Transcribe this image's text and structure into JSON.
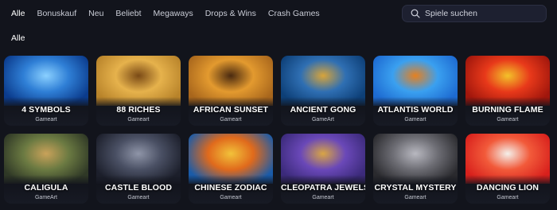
{
  "nav": {
    "tabs": [
      "Alle",
      "Bonuskauf",
      "Neu",
      "Beliebt",
      "Megaways",
      "Drops & Wins",
      "Crash Games"
    ],
    "active_tab": "Alle"
  },
  "search": {
    "placeholder": "Spiele suchen",
    "icon": "search-icon"
  },
  "section": {
    "title": "Alle"
  },
  "games": [
    {
      "title": "4 SYMBOLS",
      "provider": "Gameart",
      "colors": [
        "#0b3b8c",
        "#2f7fd6",
        "#8ad0ff"
      ]
    },
    {
      "title": "88 RICHES",
      "provider": "Gameart",
      "colors": [
        "#b8832a",
        "#e6b24c",
        "#7a4a16"
      ]
    },
    {
      "title": "AFRICAN SUNSET",
      "provider": "Gameart",
      "colors": [
        "#a8661c",
        "#e39a2f",
        "#4a2a10"
      ]
    },
    {
      "title": "ANCIENT GONG",
      "provider": "GameArt",
      "colors": [
        "#0d3f77",
        "#2f6fb3",
        "#d8a43a"
      ]
    },
    {
      "title": "ATLANTIS WORLD",
      "provider": "Gameart",
      "colors": [
        "#1d6ad1",
        "#3aa0f0",
        "#e6801f"
      ]
    },
    {
      "title": "BURNING FLAME",
      "provider": "Gameart",
      "colors": [
        "#a0160c",
        "#e8391a",
        "#f3c22a"
      ]
    },
    {
      "title": "CALIGULA",
      "provider": "GameArt",
      "colors": [
        "#2f3826",
        "#6b7a42",
        "#c9a25a"
      ]
    },
    {
      "title": "CASTLE BLOOD",
      "provider": "Gameart",
      "colors": [
        "#1c1f2b",
        "#4a5064",
        "#8f95a8"
      ]
    },
    {
      "title": "CHINESE ZODIAC",
      "provider": "Gameart",
      "colors": [
        "#1a5ba8",
        "#e06a1c",
        "#f2c23a"
      ]
    },
    {
      "title": "CLEOPATRA JEWELS",
      "provider": "Gameart",
      "colors": [
        "#3b2a7a",
        "#6a48b8",
        "#d9a544"
      ]
    },
    {
      "title": "CRYSTAL MYSTERY",
      "provider": "Gameart",
      "colors": [
        "#2a2a2e",
        "#6d6d74",
        "#b8b8c0"
      ]
    },
    {
      "title": "DANCING LION",
      "provider": "Gameart",
      "colors": [
        "#d8201c",
        "#f25a3a",
        "#f4f0ea"
      ]
    }
  ]
}
